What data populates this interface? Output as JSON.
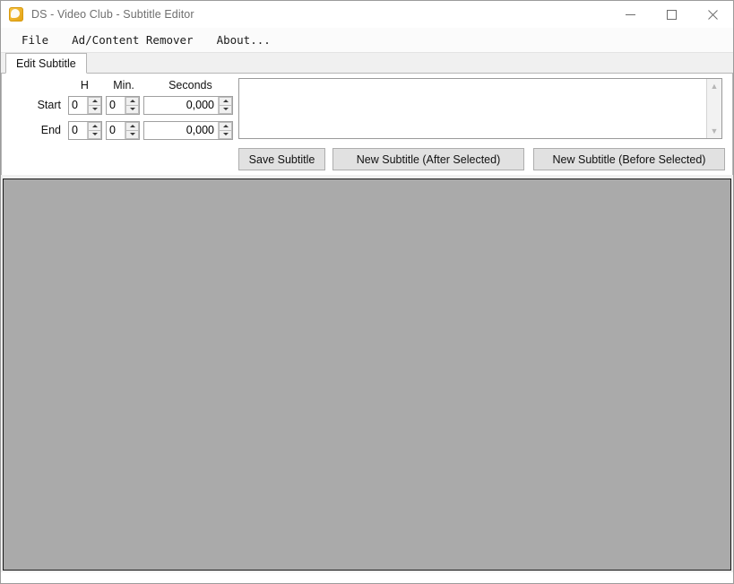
{
  "window": {
    "title": "DS - Video Club - Subtitle Editor",
    "app_icon": "app-icon",
    "controls": {
      "minimize": "minimize-icon",
      "maximize": "maximize-icon",
      "close": "close-icon"
    }
  },
  "menubar": {
    "items": [
      {
        "label": "File"
      },
      {
        "label": "Ad/Content Remover"
      },
      {
        "label": "About..."
      }
    ]
  },
  "tabs": [
    {
      "label": "Edit Subtitle",
      "selected": true
    }
  ],
  "editor": {
    "column_headers": {
      "hours": "H",
      "minutes": "Min.",
      "seconds": "Seconds"
    },
    "rows": [
      {
        "label": "Start",
        "hours": "0",
        "minutes": "0",
        "seconds": "0,000"
      },
      {
        "label": "End",
        "hours": "0",
        "minutes": "0",
        "seconds": "0,000"
      }
    ],
    "text_area": {
      "value": "",
      "placeholder": ""
    },
    "buttons": {
      "save": "Save Subtitle",
      "new_after": "New Subtitle (After Selected)",
      "new_before": "New Subtitle (Before Selected)"
    }
  },
  "preview": {
    "background_color": "#aaaaaa"
  },
  "colors": {
    "window_bg": "#ffffff",
    "tabstrip_bg": "#f0f0f0",
    "button_face": "#e1e1e1",
    "preview_gray": "#aaaaaa",
    "title_text": "#6f6f6f",
    "icon_gold": "#f0b429"
  }
}
